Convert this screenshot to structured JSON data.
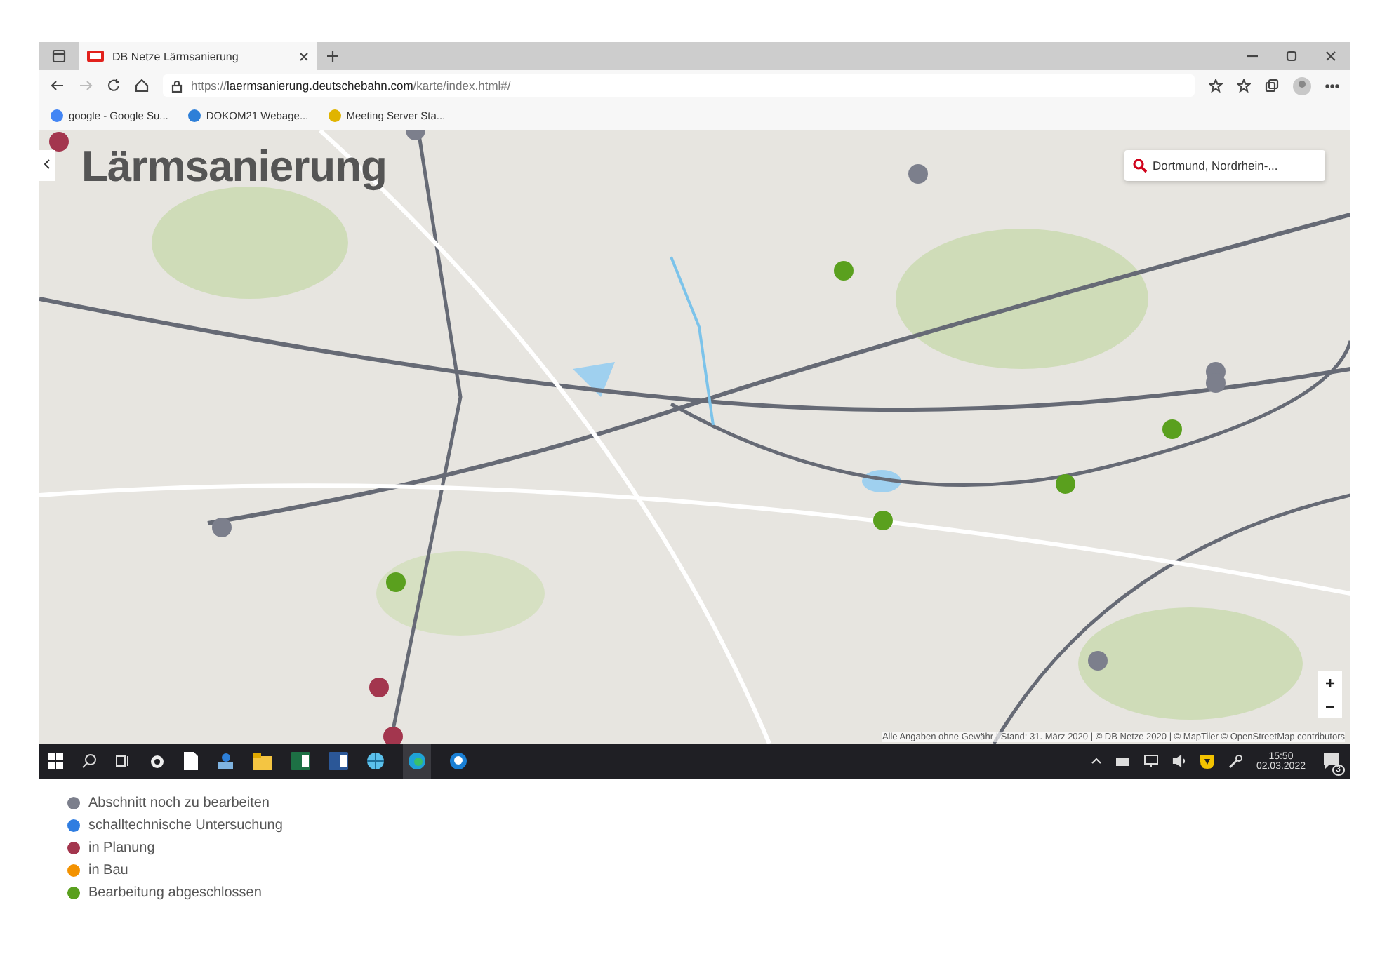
{
  "browser": {
    "tab_title": "DB Netze Lärmsanierung",
    "url_prefix": "https://",
    "url_host": "laermsanierung.deutschebahn.com",
    "url_path": "/karte/index.html#/",
    "bookmarks": [
      "google - Google Su...",
      "DOKOM21 Webage...",
      "Meeting Server Sta..."
    ]
  },
  "map": {
    "title": "Lärmsanierung",
    "search": {
      "value": "Dortmund, Nordrhein-..."
    },
    "attribution": "Alle Angaben ohne Gewähr | Stand: 31. März 2020 | © DB Netze 2020 | © MapTiler © OpenStreetMap contributors",
    "zoom_in": "+",
    "zoom_out": "−",
    "markers": [
      {
        "color": "#a3364e"
      },
      {
        "color": "#7c7f8c"
      },
      {
        "color": "#7c7f8c"
      },
      {
        "color": "#5aa01e"
      },
      {
        "color": "#7c7f8c"
      },
      {
        "color": "#7c7f8c"
      },
      {
        "color": "#5aa01e"
      },
      {
        "color": "#5aa01e"
      },
      {
        "color": "#5aa01e"
      },
      {
        "color": "#7c7f8c"
      },
      {
        "color": "#5aa01e"
      },
      {
        "color": "#a3364e"
      },
      {
        "color": "#a3364e"
      },
      {
        "color": "#7c7f8c"
      }
    ]
  },
  "taskbar": {
    "time": "15:50",
    "date": "02.03.2022",
    "notifications": "3"
  },
  "legend": [
    {
      "label": "Abschnitt noch zu bearbeiten",
      "color": "#7c7f8c"
    },
    {
      "label": "schalltechnische Untersuchung",
      "color": "#2f7de1"
    },
    {
      "label": "in Planung",
      "color": "#a3364e"
    },
    {
      "label": "in Bau",
      "color": "#f39200"
    },
    {
      "label": "Bearbeitung abgeschlossen",
      "color": "#5aa01e"
    }
  ]
}
